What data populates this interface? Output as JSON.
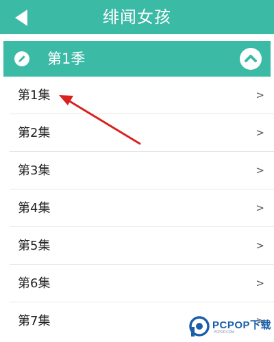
{
  "header": {
    "title": "绯闻女孩",
    "back_icon": "back-triangle-icon"
  },
  "season": {
    "label": "第1季",
    "edit_icon": "pencil-icon",
    "collapse_icon": "chevron-up-circle-icon"
  },
  "episodes": [
    {
      "label": "第1集",
      "chevron": ">"
    },
    {
      "label": "第2集",
      "chevron": ">"
    },
    {
      "label": "第3集",
      "chevron": ">"
    },
    {
      "label": "第4集",
      "chevron": ">"
    },
    {
      "label": "第5集",
      "chevron": ">"
    },
    {
      "label": "第6集",
      "chevron": ">"
    },
    {
      "label": "第7集",
      "chevron": ">"
    }
  ],
  "watermark": {
    "brand": "PCPOP下载",
    "sub": "PCPOP.COM"
  },
  "colors": {
    "accent": "#3bbaa6",
    "annotation_arrow": "#d9211e",
    "watermark_blue": "#1b5fa8"
  }
}
